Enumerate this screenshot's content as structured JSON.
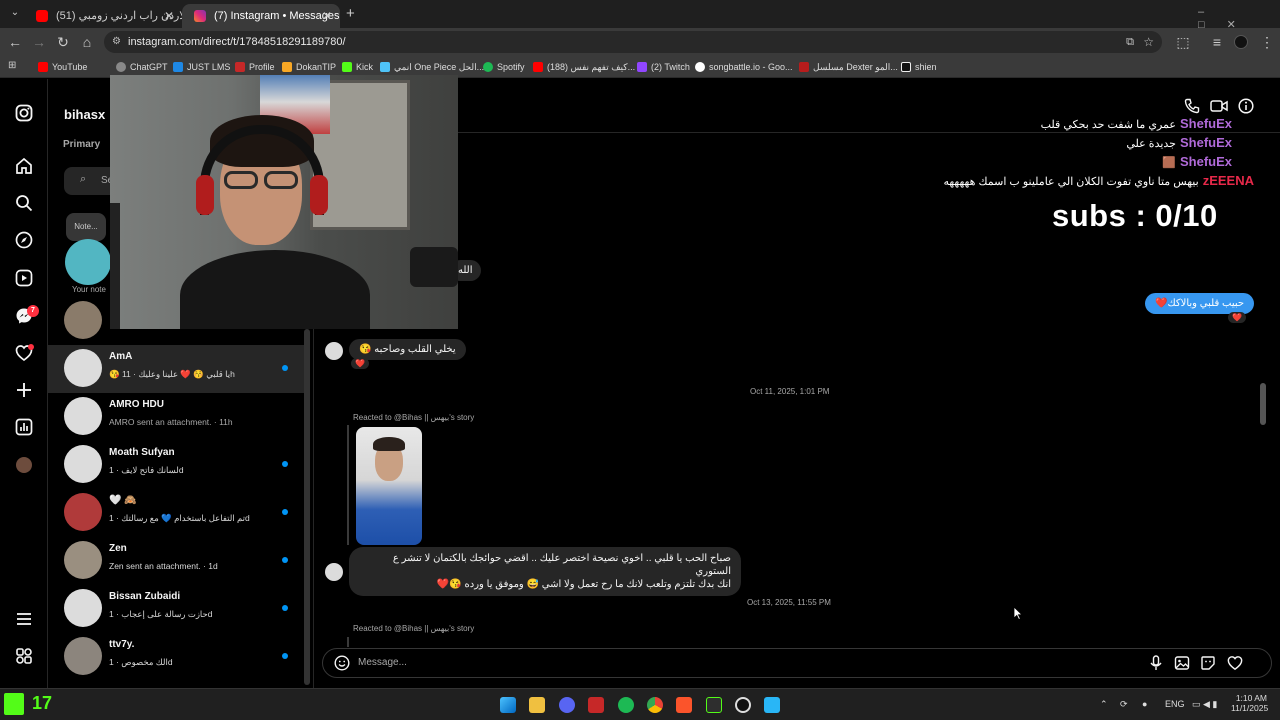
{
  "browser": {
    "tabs": [
      {
        "label": "(51) راب الاردن راب اردني زومبي",
        "active": false
      },
      {
        "label": "(7) Instagram • Messages",
        "active": true
      }
    ],
    "new_tab": "+",
    "url": "instagram.com/direct/t/17848518291189780/",
    "bookmarks": [
      "YouTube",
      "ChatGPT",
      "JUST LMS",
      "Profile",
      "DokanTIP",
      "Kick",
      "انمي One Piece الحل...",
      "Spotify",
      "(188) كيف تفهم نفس...",
      "(2) Twitch",
      "songbattle.io - Goo...",
      "مسلسل Dexter المو...",
      "shien"
    ]
  },
  "instagram": {
    "username": "bihasx",
    "primary_tab": "Primary",
    "search_placeholder": "Se",
    "note_bubble": "Note...",
    "your_note": "Your note",
    "notifications_badge": "7",
    "conversations": [
      {
        "name": "AmA",
        "preview": "😘 يا قلبي 😚 ❤️ علينا وعليك · 11h",
        "unread": true
      },
      {
        "name": "AMRO HDU",
        "preview": "AMRO sent an attachment. · 11h",
        "unread": false
      },
      {
        "name": "Moath Sufyan",
        "preview": "لسانك فاتح لايف · 1d",
        "unread": true
      },
      {
        "name": "🤍 🙈",
        "preview": "تم التفاعل باستخدام 💙 مع رسالتك · 1d",
        "unread": true
      },
      {
        "name": "Zen",
        "preview": "Zen sent an attachment. · 1d",
        "unread": true
      },
      {
        "name": "Bissan Zubaidi",
        "preview": "حازت رسالة على إعجاب · 1d",
        "unread": true
      },
      {
        "name": "ttv7y.",
        "preview": "الك مخصوص · 1d",
        "unread": true
      }
    ],
    "thread": {
      "partial_bubble": "الله",
      "sent_bubble": "حبيب قلبي وبالاكك❤️",
      "sent_reaction": "❤️",
      "msg1": "يخلي القلب وصاحبه 😘",
      "msg1_reaction": "❤️",
      "ts1": "Oct 11, 2025, 1:01 PM",
      "reacted1": "Reacted to @Bihas || بيهس's story",
      "msg2_line1": "صباح الحب يا قلبي .. اخوي نصيحة اختصر عليك .. اقضي حوائجك بالكتمان لا تنشر ع الستوري",
      "msg2_line2": "انك بدك تلتزم وتلعب لانك ما رح تعمل ولا اشي 😅 وموفق يا ورده 😘❤️",
      "ts2": "Oct 13, 2025, 11:55 PM",
      "reacted2": "Reacted to @Bihas || بيهس's story",
      "composer_placeholder": "Message..."
    }
  },
  "stream_overlay": {
    "chat": [
      {
        "user": "ShefuEx",
        "msg": "عمري ما شفت حد بحكي قلب",
        "color": "#b06ad8"
      },
      {
        "user": "ShefuEx",
        "msg": "جديدة علي",
        "color": "#b06ad8"
      },
      {
        "user": "ShefuEx",
        "msg": "🟫",
        "color": "#b06ad8"
      },
      {
        "user": "zEEENA",
        "msg": "بيهس متا ناوي تفوت الكلان الي عاملينو ب اسمك هههههه",
        "color": "#e8294a"
      }
    ],
    "subs": "subs : 0/10",
    "kick_count": "17"
  },
  "taskbar": {
    "lang": "ENG",
    "time": "1:10 AM",
    "date": "11/1/2025"
  },
  "colors": {
    "accent": "#0095f6",
    "sent_bubble": "#3797f0",
    "kick_green": "#53fc18"
  }
}
